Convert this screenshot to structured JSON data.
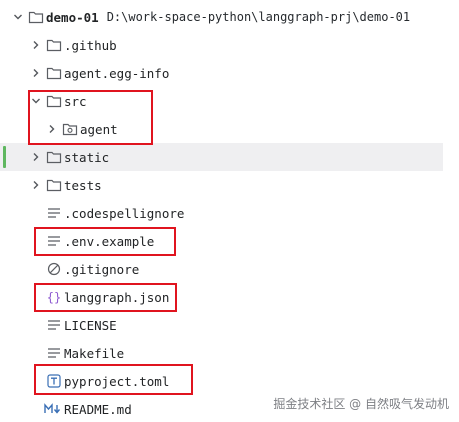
{
  "project": {
    "name": "demo-01",
    "path": "D:\\work-space-python\\langgraph-prj\\demo-01"
  },
  "items": [
    {
      "label": ".github",
      "type": "folder",
      "expanded": false
    },
    {
      "label": "agent.egg-info",
      "type": "folder",
      "expanded": false
    },
    {
      "label": "src",
      "type": "folder",
      "expanded": true
    },
    {
      "label": "agent",
      "type": "package-folder",
      "expanded": false
    },
    {
      "label": "static",
      "type": "folder",
      "expanded": false,
      "selected": true
    },
    {
      "label": "tests",
      "type": "folder",
      "expanded": false
    },
    {
      "label": ".codespellignore",
      "type": "text-file"
    },
    {
      "label": ".env.example",
      "type": "text-file"
    },
    {
      "label": ".gitignore",
      "type": "ignore-file"
    },
    {
      "label": "langgraph.json",
      "type": "json-file"
    },
    {
      "label": "LICENSE",
      "type": "text-file"
    },
    {
      "label": "Makefile",
      "type": "text-file"
    },
    {
      "label": "pyproject.toml",
      "type": "toml-file"
    },
    {
      "label": "README.md",
      "type": "markdown-file"
    }
  ],
  "watermark": "掘金技术社区 @ 自然吸气发动机",
  "colors": {
    "highlight_box": "#e0141f",
    "selected_row": "#efeff1",
    "change_marker": "#5fb760",
    "json_icon": "#8e5bd1",
    "toml_icon": "#3a6fb5"
  }
}
